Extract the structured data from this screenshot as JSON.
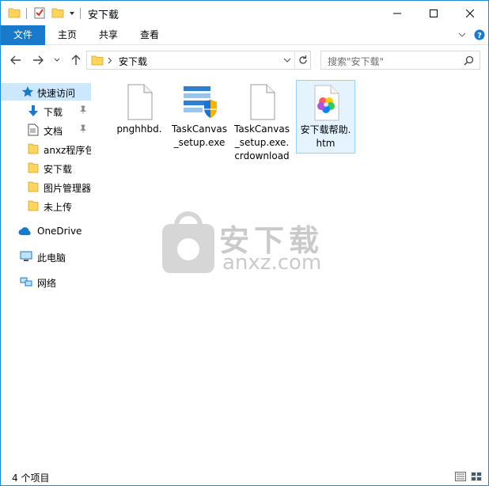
{
  "window": {
    "title": "安下载",
    "controls": {
      "minimize": "minimize-icon",
      "maximize": "maximize-icon",
      "close": "close-icon"
    }
  },
  "ribbon": {
    "tabs": [
      {
        "label": "文件"
      },
      {
        "label": "主页"
      },
      {
        "label": "共享"
      },
      {
        "label": "查看"
      }
    ]
  },
  "address": {
    "path": "安下载",
    "search_placeholder": "搜索\"安下载\""
  },
  "sidebar": {
    "quick_access": "快速访问",
    "items": [
      {
        "label": "下载",
        "pinned": true
      },
      {
        "label": "文档",
        "pinned": true
      },
      {
        "label": "anxz程序包",
        "pinned": false
      },
      {
        "label": "安下载",
        "pinned": false
      },
      {
        "label": "图片管理器",
        "pinned": false
      },
      {
        "label": "未上传",
        "pinned": false
      }
    ],
    "onedrive": "OneDrive",
    "this_pc": "此电脑",
    "network": "网络"
  },
  "files": [
    {
      "name": "pnghhbd.",
      "icon": "blank-file-icon",
      "selected": false
    },
    {
      "name": "TaskCanvas_setup.exe",
      "icon": "installer-exe-icon",
      "selected": false
    },
    {
      "name": "TaskCanvas_setup.exe.crdownload",
      "icon": "blank-file-icon",
      "selected": false
    },
    {
      "name": "安下载帮助.htm",
      "icon": "htm-file-icon",
      "selected": true
    }
  ],
  "watermark": {
    "text": "安下载",
    "sub": "anxz.com"
  },
  "status": {
    "count": "4 个项目"
  },
  "colors": {
    "accent": "#1979ca",
    "selected_nav": "#cce8ff",
    "folder": "#ffd35c"
  }
}
